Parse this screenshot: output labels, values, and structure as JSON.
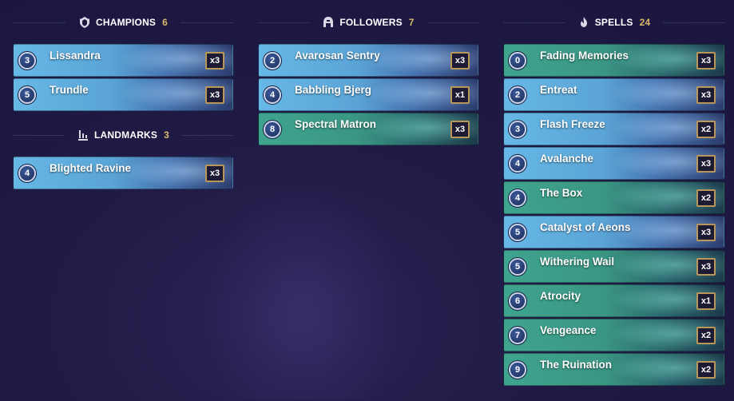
{
  "champions": {
    "title": "CHAMPIONS",
    "count": "6",
    "icon": "champion-helmet-icon",
    "cards": [
      {
        "cost": "3",
        "name": "Lissandra",
        "qty": "x3",
        "style": "blue"
      },
      {
        "cost": "5",
        "name": "Trundle",
        "qty": "x3",
        "style": "blue"
      }
    ]
  },
  "landmarks": {
    "title": "LANDMARKS",
    "count": "3",
    "icon": "landmark-icon",
    "cards": [
      {
        "cost": "4",
        "name": "Blighted Ravine",
        "qty": "x3",
        "style": "blue"
      }
    ]
  },
  "followers": {
    "title": "FOLLOWERS",
    "count": "7",
    "icon": "follower-helmet-icon",
    "cards": [
      {
        "cost": "2",
        "name": "Avarosan Sentry",
        "qty": "x3",
        "style": "blue"
      },
      {
        "cost": "4",
        "name": "Babbling Bjerg",
        "qty": "x1",
        "style": "blue"
      },
      {
        "cost": "8",
        "name": "Spectral Matron",
        "qty": "x3",
        "style": "green"
      }
    ]
  },
  "spells": {
    "title": "SPELLS",
    "count": "24",
    "icon": "spell-flame-icon",
    "cards": [
      {
        "cost": "0",
        "name": "Fading Memories",
        "qty": "x3",
        "style": "green"
      },
      {
        "cost": "2",
        "name": "Entreat",
        "qty": "x3",
        "style": "blue"
      },
      {
        "cost": "3",
        "name": "Flash Freeze",
        "qty": "x2",
        "style": "blue"
      },
      {
        "cost": "4",
        "name": "Avalanche",
        "qty": "x3",
        "style": "blue"
      },
      {
        "cost": "4",
        "name": "The Box",
        "qty": "x2",
        "style": "green"
      },
      {
        "cost": "5",
        "name": "Catalyst of Aeons",
        "qty": "x3",
        "style": "blue"
      },
      {
        "cost": "5",
        "name": "Withering Wail",
        "qty": "x3",
        "style": "green"
      },
      {
        "cost": "6",
        "name": "Atrocity",
        "qty": "x1",
        "style": "green"
      },
      {
        "cost": "7",
        "name": "Vengeance",
        "qty": "x2",
        "style": "green"
      },
      {
        "cost": "9",
        "name": "The Ruination",
        "qty": "x2",
        "style": "green"
      }
    ]
  },
  "colors": {
    "background": "#1f1a44",
    "count_accent": "#d8b86a",
    "qty_border": "#b99659"
  }
}
